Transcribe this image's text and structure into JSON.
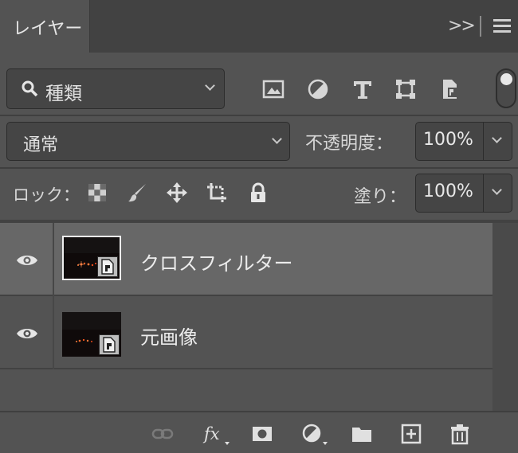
{
  "panel": {
    "tab_label": "レイヤー",
    "collapse_glyph": ">>"
  },
  "filter": {
    "kind_label": "種類",
    "toggle_state": "on"
  },
  "blend": {
    "mode": "通常",
    "opacity_label": "不透明度：",
    "opacity_value": "100%"
  },
  "lock": {
    "label": "ロック：",
    "fill_label": "塗り：",
    "fill_value": "100%"
  },
  "layers": [
    {
      "name": "クロスフィルター",
      "selected": true,
      "visible": true,
      "type": "smart-object"
    },
    {
      "name": "元画像",
      "selected": false,
      "visible": true,
      "type": "smart-object"
    }
  ],
  "colors": {
    "panel_bg": "#535353",
    "tab_bar_bg": "#424242",
    "selected_row_bg": "#676767",
    "field_bg": "#454545"
  }
}
